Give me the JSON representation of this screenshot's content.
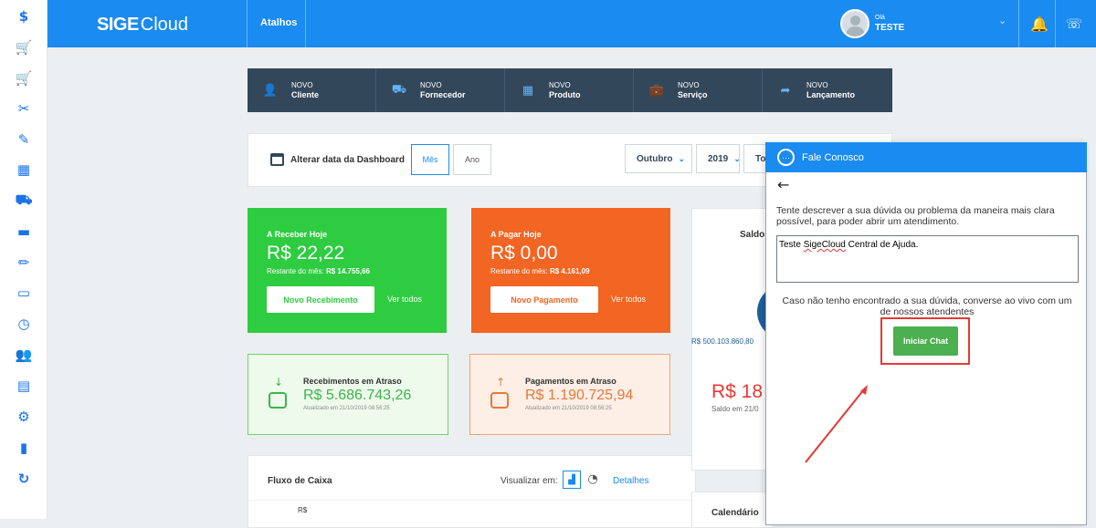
{
  "rail": {
    "icons": [
      "dollar-icon",
      "cart-icon",
      "cart-add-icon",
      "tools-icon",
      "edit-icon",
      "boxes-icon",
      "truck-icon",
      "car-icon",
      "pencil-icon",
      "monitor-icon",
      "clock-icon",
      "users-icon",
      "document-icon",
      "gear-icon",
      "bar-chart-icon",
      "refresh-icon"
    ],
    "glyphs": [
      "$",
      "🛒",
      "🛒",
      "✂",
      "✎",
      "▦",
      "⛟",
      "▬",
      "✏",
      "▭",
      "◷",
      "👥",
      "▤",
      "⚙",
      "▮",
      "↻"
    ]
  },
  "topbar": {
    "logo_sige": "SIGE",
    "logo_cloud": "Cloud",
    "atalhos": "Atalhos",
    "greeting": "Olá",
    "username": "TESTE",
    "bell_glyph": "🔔",
    "phone_glyph": "☏",
    "caret": "⌄"
  },
  "shortcuts": [
    {
      "small": "NOVO",
      "big": "Cliente",
      "icon": "person-icon",
      "glyph": "👤"
    },
    {
      "small": "NOVO",
      "big": "Fornecedor",
      "icon": "truck-icon",
      "glyph": "⛟"
    },
    {
      "small": "NOVO",
      "big": "Produto",
      "icon": "boxes-icon",
      "glyph": "▦"
    },
    {
      "small": "NOVO",
      "big": "Serviço",
      "icon": "briefcase-icon",
      "glyph": "💼"
    },
    {
      "small": "NOVO",
      "big": "Lançamento",
      "icon": "share-icon",
      "glyph": "➦"
    }
  ],
  "filter": {
    "label": "Alterar data da Dashboard",
    "mes": "Mês",
    "ano": "Ano",
    "month": "Outubro",
    "year": "2019",
    "third": "To"
  },
  "receber": {
    "title": "A Receber Hoje",
    "value": "R$ 22,22",
    "rest_label": "Restante do mês:",
    "rest_value": "R$ 14.755,66",
    "button": "Novo Recebimento",
    "link": "Ver todos"
  },
  "pagar": {
    "title": "A Pagar Hoje",
    "value": "R$ 0,00",
    "rest_label": "Restante do mês:",
    "rest_value": "R$ 4.161,09",
    "button": "Novo Pagamento",
    "link": "Ver todos"
  },
  "receb_atraso": {
    "title": "Recebimentos em Atraso",
    "value": "R$ 5.686.743,26",
    "updated": "Atualizado em 21/10/2019 08:56:25"
  },
  "pag_atraso": {
    "title": "Pagamentos em Atraso",
    "value": "R$ 1.190.725,94",
    "updated": "Atualizado em 21/10/2019 08:56:25"
  },
  "fluxo": {
    "title": "Fluxo de Caixa",
    "visualizar": "Visualizar em:",
    "detalhes": "Detalhes",
    "rs": "R$"
  },
  "saldo": {
    "title": "Saldo",
    "rs": "R$ 500.103.860,80",
    "big": "R$ 18",
    "sub": "Saldo em 21/0"
  },
  "calendario": {
    "title": "Calendário"
  },
  "chat": {
    "title": "Fale Conosco",
    "back": "←",
    "description": "Tente descrever a sua dúvida ou problema da maneira mais clara possível, para poder abrir um atendimento.",
    "text_prefix": "Teste ",
    "text_underlined": "SigeCloud",
    "text_suffix": " Central de Ajuda.",
    "live_text": "Caso não tenho encontrado a sua dúvida, converse ao vivo com um de nossos atendentes",
    "button": "Iniciar Chat"
  },
  "colors": {
    "primary": "#1a8bf0",
    "dark": "#33475b",
    "green": "#2ecc40",
    "orange": "#f26522",
    "red": "#e53935"
  }
}
